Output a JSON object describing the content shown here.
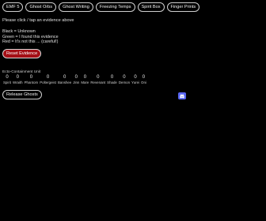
{
  "evidence": [
    {
      "id": "emf5",
      "label": "EMF 5"
    },
    {
      "id": "ghost-orbs",
      "label": "Ghost Orbs"
    },
    {
      "id": "ghost-writing",
      "label": "Ghost Writing"
    },
    {
      "id": "freezing-temps",
      "label": "Freezing Temps"
    },
    {
      "id": "spirit-box",
      "label": "Spirit Box"
    },
    {
      "id": "finger-prints",
      "label": "Finger Prints"
    }
  ],
  "instruction": "Please click / tap an evidence above",
  "legend": {
    "black": "Black  = Unknown",
    "green": "Green = I found this evidence",
    "red": "Red     = It's not this ... (careful!)"
  },
  "reset_label": "Reset Evidence",
  "section_label": "Ecto-Containment Unit",
  "ghosts": [
    {
      "name": "Spirit",
      "count": "0"
    },
    {
      "name": "Wraith",
      "count": "0"
    },
    {
      "name": "Phantom",
      "count": "0"
    },
    {
      "name": "Poltergeist",
      "count": "0"
    },
    {
      "name": "Banshee",
      "count": "0"
    },
    {
      "name": "Jinn",
      "count": "0"
    },
    {
      "name": "Mare",
      "count": "0"
    },
    {
      "name": "Revenant",
      "count": "0"
    },
    {
      "name": "Shade",
      "count": "0"
    },
    {
      "name": "Demon",
      "count": "0"
    },
    {
      "name": "Yurei",
      "count": "0"
    },
    {
      "name": "Oni",
      "count": "0"
    }
  ],
  "release_label": "Release Ghosts",
  "icons": {
    "discord": "discord-icon"
  },
  "colors": {
    "background": "#000000",
    "reset": "#a40f16",
    "discord": "#5865f2"
  }
}
